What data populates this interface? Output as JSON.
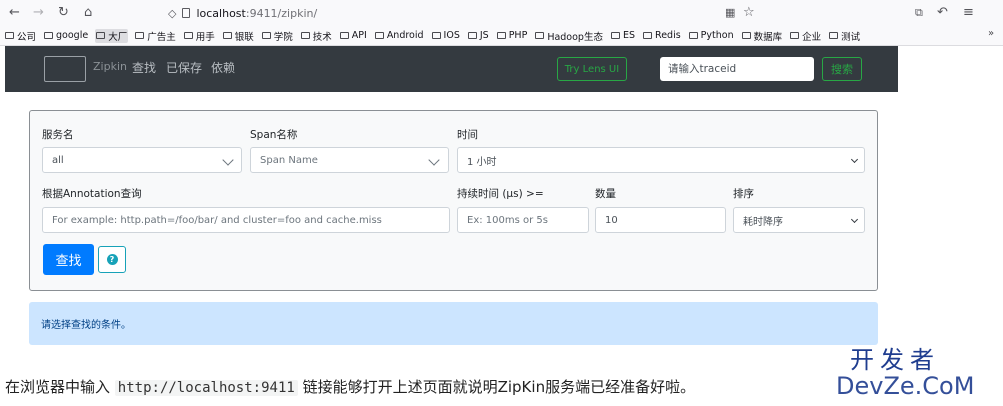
{
  "browser": {
    "address_host": "localhost",
    "address_path": ":9411/zipkin/",
    "bookmarks": [
      "公司",
      "google",
      "大厂",
      "广告主",
      "用手",
      "银联",
      "学院",
      "技术",
      "API",
      "Android",
      "IOS",
      "JS",
      "PHP",
      "Hadoop生态",
      "ES",
      "Redis",
      "Python",
      "数据库",
      "企业",
      "测试"
    ],
    "active_bookmark_index": 2
  },
  "navbar": {
    "brand": "Zipkin",
    "links": [
      "查找",
      "已保存",
      "依赖"
    ],
    "lens_button": "Try Lens UI",
    "traceid_placeholder": "请输入traceid",
    "search_button": "搜索"
  },
  "form": {
    "service_label": "服务名",
    "service_value": "all",
    "span_label": "Span名称",
    "span_placeholder": "Span Name",
    "time_label": "时间",
    "time_value": "1 小时",
    "annotation_label": "根据Annotation查询",
    "annotation_placeholder": "For example: http.path=/foo/bar/ and cluster=foo and cache.miss",
    "duration_label": "持续时间 (μs) >=",
    "duration_placeholder": "Ex: 100ms or 5s",
    "limit_label": "数量",
    "limit_value": "10",
    "sort_label": "排序",
    "sort_value": "耗时降序",
    "find_button": "查找"
  },
  "alert": {
    "text": "请选择查找的条件。"
  },
  "caption": {
    "before": "在浏览器中输入",
    "code": "http://localhost:9411",
    "after": "链接能够打开上述页面就说明ZipKin服务端已经准备好啦。"
  },
  "watermark": {
    "line1": "开发者",
    "line2": "DevZe.CoM"
  },
  "colors": {
    "navbar_bg": "#343a40",
    "primary": "#007bff",
    "success": "#28a745",
    "info": "#17a2b8",
    "alert_bg": "#cce5ff"
  }
}
